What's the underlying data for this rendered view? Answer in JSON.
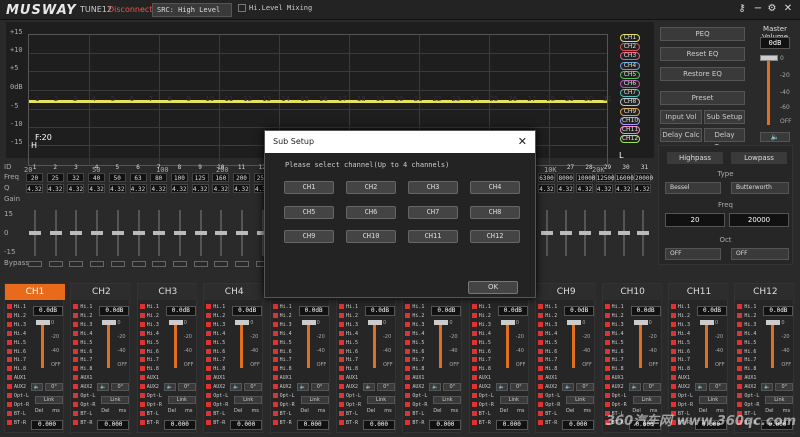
{
  "header": {
    "logo": "MUSWAY",
    "model": "TUNE12",
    "connection": "Disconnect",
    "src_label": "SRC: High Level",
    "hi_level_mixing": "Hi.Level Mixing"
  },
  "eq": {
    "y_labels": [
      "+15",
      "+10",
      "+5",
      "0dB",
      "-5",
      "-10",
      "-15"
    ],
    "x_labels": [
      "20",
      "50",
      "100",
      "200",
      "5K",
      "10K",
      "20K"
    ],
    "band_markers": [
      "1",
      "2",
      "3",
      "4",
      "5",
      "6",
      "7",
      "8",
      "9",
      "10",
      "11",
      "12",
      "13",
      "14",
      "15",
      "16",
      "17",
      "18",
      "19",
      "20",
      "21",
      "22",
      "23",
      "24",
      "25",
      "26",
      "27",
      "28",
      "29",
      "30",
      "31"
    ],
    "f_marker": "F:20",
    "h_marker": "H",
    "l_marker": "L",
    "channel_tags": [
      "CH1",
      "CH2",
      "CH3",
      "CH4",
      "CH5",
      "CH6",
      "CH7",
      "CH8",
      "CH9",
      "CH10",
      "CH11",
      "CH12"
    ],
    "channel_tag_colors": [
      "#e8e05a",
      "#e05050",
      "#e06080",
      "#60a0e0",
      "#50c050",
      "#c050c0",
      "#50c0c0",
      "#c0c0c0",
      "#e0a040",
      "#a0a0ff",
      "#ff80c0",
      "#a0e060"
    ]
  },
  "right_buttons": {
    "peq": "PEQ",
    "reset_eq": "Reset EQ",
    "restore_eq": "Restore EQ",
    "preset": "Preset",
    "input_vol": "Input Vol",
    "sub_setup": "Sub Setup",
    "delay_calc": "Delay Calc",
    "delay_group": "Delay Group"
  },
  "master_volume": {
    "title": "Master Volume",
    "value": "0dB",
    "ticks": [
      "0",
      "-20",
      "-40",
      "-60",
      "OFF"
    ]
  },
  "filter": {
    "highpass": "Highpass",
    "lowpass": "Lowpass",
    "type_label": "Type",
    "hp_type": "Bessel",
    "lp_type": "Butterworth",
    "freq_label": "Freq",
    "hp_freq": "20",
    "lp_freq": "20000",
    "oct_label": "Oct",
    "hp_oct": "OFF",
    "lp_oct": "OFF"
  },
  "band_table": {
    "row_labels": [
      "ID",
      "Freq",
      "Q",
      "Gain"
    ],
    "ids": [
      "1",
      "2",
      "3",
      "4",
      "5",
      "6",
      "7",
      "8",
      "9",
      "10",
      "11",
      "12"
    ],
    "freqs": [
      "20",
      "25",
      "32",
      "40",
      "50",
      "63",
      "80",
      "100",
      "125",
      "160",
      "200",
      "250"
    ],
    "qs": [
      "4.32",
      "4.32",
      "4.32",
      "4.32",
      "4.32",
      "4.32",
      "4.32",
      "4.32",
      "4.32",
      "4.32",
      "4.32",
      "4.32"
    ],
    "right_ids": [
      "27",
      "28",
      "29",
      "30",
      "31"
    ],
    "right_freqs": [
      "6300",
      "8000",
      "10000",
      "12500",
      "16000",
      "20000"
    ],
    "right_qs": [
      "4.32",
      "4.32",
      "4.32",
      "4.32",
      "4.32",
      "4.32"
    ],
    "slider_labels": [
      "15",
      "0",
      "-15"
    ],
    "bypass_label": "Bypass"
  },
  "channels": [
    {
      "name": "CH1",
      "gain": "0.0dB",
      "delay": "0.000"
    },
    {
      "name": "CH2",
      "gain": "0.0dB",
      "delay": "0.000"
    },
    {
      "name": "CH3",
      "gain": "0.0dB",
      "delay": "0.000"
    },
    {
      "name": "CH4",
      "gain": "0.0dB",
      "delay": "0.000"
    },
    {
      "name": "CH5",
      "gain": "0.0dB",
      "delay": "0.000"
    },
    {
      "name": "CH6",
      "gain": "0.0dB",
      "delay": "0.000"
    },
    {
      "name": "CH7",
      "gain": "0.0dB",
      "delay": "0.000"
    },
    {
      "name": "CH8",
      "gain": "0.0dB",
      "delay": "0.000"
    },
    {
      "name": "CH9",
      "gain": "0.0dB",
      "delay": "0.000"
    },
    {
      "name": "CH10",
      "gain": "0.0dB",
      "delay": "0.000"
    },
    {
      "name": "CH11",
      "gain": "0.0dB",
      "delay": "0.000"
    },
    {
      "name": "CH12",
      "gain": "0.0dB",
      "delay": "0.000"
    }
  ],
  "strip_labels": {
    "hi_rows": [
      "Hi.1",
      "Hi.2",
      "Hi.3",
      "Hi.4",
      "Hi.5",
      "Hi.6",
      "Hi.7",
      "Hi.8",
      "AUX1",
      "AUX2",
      "Opt-L",
      "Opt-R",
      "BT-L",
      "BT-R"
    ],
    "fader_ticks": [
      "0",
      "-20",
      "-40",
      "OFF"
    ],
    "phase": "0°",
    "link": "Link",
    "del": "Del",
    "ms": "ms"
  },
  "dialog": {
    "title": "Sub Setup",
    "close": "✕",
    "message": "Please select channel(Up to 4 channels)",
    "buttons": [
      "CH1",
      "CH2",
      "CH3",
      "CH4",
      "CH5",
      "CH6",
      "CH7",
      "CH8",
      "CH9",
      "CH10",
      "CH11",
      "CH12"
    ],
    "ok": "OK"
  },
  "watermark": "360汽车网 www.360qc.com"
}
